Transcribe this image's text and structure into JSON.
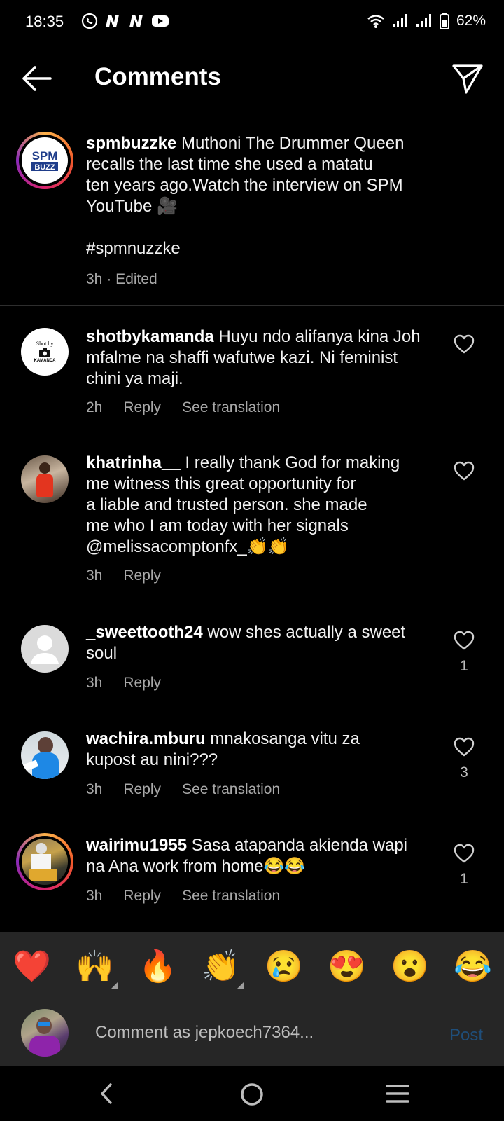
{
  "status": {
    "time": "18:35",
    "battery": "62%",
    "icons": [
      "whatsapp-icon",
      "n-icon",
      "n-icon",
      "youtube-icon",
      "wifi-icon",
      "signal-icon",
      "signal-icon",
      "battery-icon"
    ]
  },
  "appbar": {
    "title": "Comments"
  },
  "caption": {
    "username": "spmbuzzke",
    "text_line1": "Muthoni The Drummer Queen",
    "text_line2": "recalls the last time she used a matatu",
    "text_line3": "ten years ago.Watch the interview on SPM",
    "text_line4": "YouTube 🎥",
    "hashtag": "#spmnuzzke",
    "time": "3h",
    "edited": "· Edited"
  },
  "comments": [
    {
      "username": "shotbykamanda",
      "line1": "Huyu ndo alifanya kina Joh",
      "line2": "mfalme na shaffi wafutwe kazi.  Ni feminist",
      "line3": "chini ya maji.",
      "time": "2h",
      "reply": "Reply",
      "translate": "See translation",
      "avatar_text1": "Shot by",
      "avatar_text2": "KAMANDA"
    },
    {
      "username": "khatrinha__",
      "line1": "I really thank God for making",
      "line2": "me witness this great opportunity for",
      "line3": "a liable and trusted person. she made",
      "line4": "me who I am today with her signals",
      "line5": "@melissacomptonfx_👏👏",
      "time": "3h",
      "reply": "Reply"
    },
    {
      "username": "_sweettooth24",
      "line1": "wow shes actually a sweet",
      "line2": "soul",
      "time": "3h",
      "reply": "Reply",
      "likes": "1"
    },
    {
      "username": "wachira.mburu",
      "line1": "mnakosanga  vitu za",
      "line2": "kupost au nini???",
      "time": "3h",
      "reply": "Reply",
      "translate": "See translation",
      "likes": "3"
    },
    {
      "username": "wairimu1955",
      "line1": "Sasa atapanda akienda wapi",
      "line2": "na Ana work from home😂😂",
      "time": "3h",
      "reply": "Reply",
      "translate": "See translation",
      "likes": "1"
    }
  ],
  "emoji_bar": [
    "❤️",
    "🙌",
    "🔥",
    "👏",
    "😢",
    "😍",
    "😮",
    "😂"
  ],
  "composer": {
    "placeholder": "Comment as jepkoech7364...",
    "post": "Post"
  },
  "colors": {
    "background": "#000000",
    "secondary_text": "#a8a8a8",
    "post_disabled": "#1f4e7a",
    "panel": "#262626"
  }
}
